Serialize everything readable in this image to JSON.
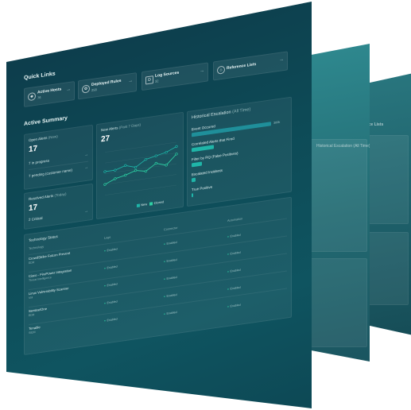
{
  "quick_links": {
    "title": "Quick Links",
    "items": [
      {
        "label": "Active Hosts",
        "count": "76",
        "icon": "shield-icon"
      },
      {
        "label": "Deployed Rules",
        "count": "258",
        "icon": "gear-icon"
      },
      {
        "label": "Log Sources",
        "count": "32",
        "icon": "document-icon"
      },
      {
        "label": "Reference Lists",
        "count": "",
        "icon": "tag-icon"
      }
    ]
  },
  "active_summary": {
    "title": "Active Summary",
    "open_alerts": {
      "label": "Open Alerts",
      "qualifier": "(Now)",
      "value": "17",
      "rows": [
        "7 in progress",
        "7 pending (customer name)"
      ]
    },
    "resolved_alerts": {
      "label": "Resolved Alerts",
      "qualifier": "(Today)",
      "value": "17",
      "rows": [
        "2 Critical"
      ]
    },
    "new_alerts": {
      "label": "New Alerts",
      "qualifier": "(Past 7 Days)",
      "value": "27"
    },
    "historical": {
      "label": "Historical Escalation",
      "qualifier": "(All Time)",
      "bars": [
        {
          "label": "Event Occured",
          "value": "300k",
          "fraction": 1.0
        },
        {
          "label": "Correlated Alerts that Fired",
          "value": "",
          "fraction": 0.28
        },
        {
          "label": "Filter by RQ (False Positives)",
          "value": "",
          "fraction": 0.13
        },
        {
          "label": "Escalated Incidents",
          "value": "",
          "fraction": 0.05
        },
        {
          "label": "True Positive",
          "value": "",
          "fraction": 0.02
        }
      ]
    }
  },
  "chart_data": {
    "type": "line",
    "categories": [
      "",
      "",
      "",
      "",
      "",
      "",
      "",
      ""
    ],
    "series": [
      {
        "name": "New",
        "color": "#1fb5a8",
        "values": [
          2.2,
          2.2,
          2.5,
          2.2,
          2.8,
          3.0,
          3.2,
          3.6
        ]
      },
      {
        "name": "Closed",
        "color": "#2fd0a4",
        "values": [
          1.0,
          1.4,
          1.6,
          1.9,
          1.7,
          2.3,
          2.0,
          2.9
        ]
      }
    ],
    "ylim": [
      0,
      4
    ],
    "legend_position": "bottom-right",
    "grid": true
  },
  "technology": {
    "title": "Technology Status",
    "columns": [
      "Technology",
      "Logs",
      "Connector",
      "Automation"
    ],
    "rows": [
      {
        "name": "CrowdStrike Falcon Prevent",
        "sub": "EDR",
        "statuses": [
          "Enabled",
          "Enabled",
          "Enabled"
        ]
      },
      {
        "name": "Cisco - FirePower Integration",
        "sub": "Threat Intelligence",
        "statuses": [
          "Enabled",
          "Enabled",
          "Enabled"
        ]
      },
      {
        "name": "Linux Vulnerability Scanner",
        "sub": "VM",
        "statuses": [
          "Enabled",
          "Enabled",
          "Enabled"
        ]
      },
      {
        "name": "SentinelOne",
        "sub": "EDR",
        "statuses": [
          "Enabled",
          "Enabled",
          "Enabled"
        ]
      },
      {
        "name": "Tenable",
        "sub": "SIEM",
        "statuses": [
          "Enabled",
          "Enabled",
          "Enabled"
        ]
      }
    ]
  },
  "back_panel": {
    "title": "Reference Lists",
    "subtitle": "Historical Escalation (All Time)"
  }
}
